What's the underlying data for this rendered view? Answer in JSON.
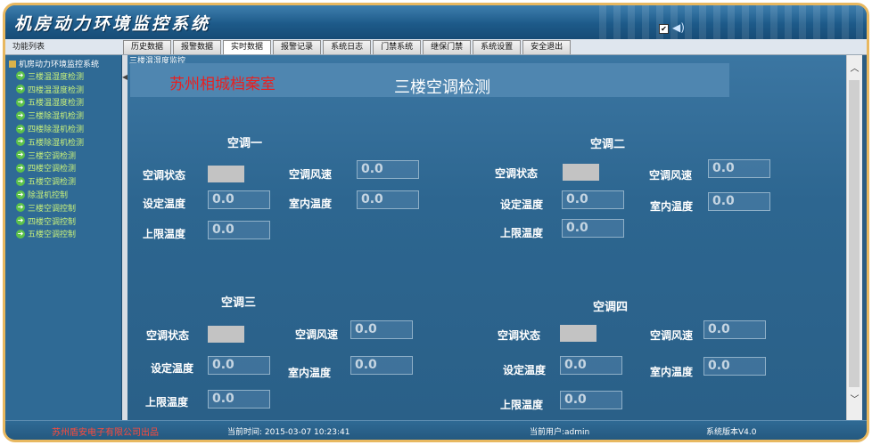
{
  "app": {
    "title": "机房动力环境监控系统"
  },
  "menubar": {
    "label": "功能列表",
    "tabs": [
      "历史数据",
      "报警数据",
      "实时数据",
      "报警记录",
      "系统日志",
      "门禁系统",
      "继保门禁",
      "系统设置",
      "安全退出"
    ],
    "active_tab": "实时数据"
  },
  "sidebar": {
    "root": "机房动力环境监控系统",
    "items": [
      "三楼温湿度检测",
      "四楼温湿度检测",
      "五楼温湿度检测",
      "三楼除湿机检测",
      "四楼除湿机检测",
      "五楼除湿机检测",
      "三楼空调检测",
      "四楼空调检测",
      "五楼空调检测",
      "除湿机控制",
      "三楼空调控制",
      "四楼空调控制",
      "五楼空调控制"
    ]
  },
  "main": {
    "breadcrumb": "三楼温湿度监控",
    "company": "苏州相城档案室",
    "heading": "三楼空调检测",
    "units": [
      {
        "title": "空调一",
        "status_label": "空调状态",
        "wind_label": "空调风速",
        "wind_value": "0.0",
        "set_label": "设定温度",
        "set_value": "0.0",
        "indoor_label": "室内温度",
        "indoor_value": "0.0",
        "upper_label": "上限温度",
        "upper_value": "0.0"
      },
      {
        "title": "空调二",
        "status_label": "空调状态",
        "wind_label": "空调风速",
        "wind_value": "0.0",
        "set_label": "设定温度",
        "set_value": "0.0",
        "indoor_label": "室内温度",
        "indoor_value": "0.0",
        "upper_label": "上限温度",
        "upper_value": "0.0"
      },
      {
        "title": "空调三",
        "status_label": "空调状态",
        "wind_label": "空调风速",
        "wind_value": "0.0",
        "set_label": "设定温度",
        "set_value": "0.0",
        "indoor_label": "室内温度",
        "indoor_value": "0.0",
        "upper_label": "上限温度",
        "upper_value": "0.0"
      },
      {
        "title": "空调四",
        "status_label": "空调状态",
        "wind_label": "空调风速",
        "wind_value": "0.0",
        "set_label": "设定温度",
        "set_value": "0.0",
        "indoor_label": "室内温度",
        "indoor_value": "0.0",
        "upper_label": "上限温度",
        "upper_value": "0.0"
      }
    ]
  },
  "footer": {
    "company": "苏州盾安电子有限公司出品",
    "time": "当前时间: 2015-03-07 10:23:41",
    "user": "当前用户:admin",
    "version": "系统版本V4.0"
  },
  "colors": {
    "accent": "#e8b860",
    "company": "#e82020"
  },
  "icons": {
    "tree": "green-arrow-icon",
    "root": "folder-icon",
    "sound": "speaker-icon"
  }
}
